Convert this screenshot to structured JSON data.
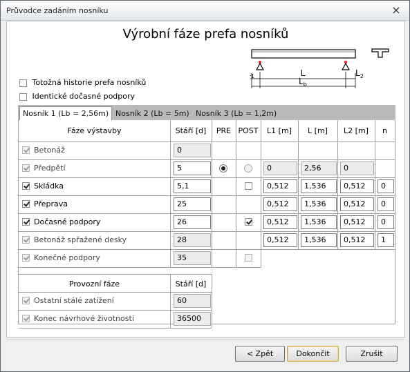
{
  "window": {
    "title": "Průvodce zadáním nosníku",
    "close_label": "×"
  },
  "heading": "Výrobní fáze prefa nosníků",
  "diagram": {
    "l1": "L",
    "l1_sub": "1",
    "l": "L",
    "l2": "L",
    "l2_sub": "2",
    "lb": "L",
    "lb_sub": "b"
  },
  "options": [
    {
      "label": "Totožná historie prefa nosníků",
      "checked": false
    },
    {
      "label": "Identické dočasné podpory",
      "checked": false
    }
  ],
  "tabs": [
    {
      "label": "Nosník  1 (Lb = 2,56m)",
      "active": true
    },
    {
      "label": "Nosník  2 (Lb = 5m)",
      "active": false
    },
    {
      "label": "Nosník  3 (Lb = 1,2m)",
      "active": false
    }
  ],
  "table": {
    "headers": {
      "phase": "Fáze výstavby",
      "age": "Stáří [d]",
      "pre": "PRE",
      "post": "POST",
      "l1": "L1 [m]",
      "l": "L [m]",
      "l2": "L2 [m]",
      "n": "n"
    },
    "rows": [
      {
        "label": "Betonáž",
        "age": "0"
      },
      {
        "label": "Předpětí",
        "age": "5",
        "l1": "0",
        "l": "2,56",
        "l2": "0"
      },
      {
        "label": "Skládka",
        "age": "5,1",
        "l1": "0,512",
        "l": "1,536",
        "l2": "0,512",
        "n": "0"
      },
      {
        "label": "Přeprava",
        "age": "25",
        "l1": "0,512",
        "l": "1,536",
        "l2": "0,512",
        "n": "0"
      },
      {
        "label": "Dočasné podpory",
        "age": "26",
        "l1": "0,512",
        "l": "1,536",
        "l2": "0,512",
        "n": "0"
      },
      {
        "label": "Betonáž spřažené desky",
        "age": "28",
        "l1": "0,512",
        "l": "1,536",
        "l2": "0,512",
        "n": "1"
      },
      {
        "label": "Konečné podpory",
        "age": "35"
      }
    ]
  },
  "service": {
    "headers": {
      "phase": "Provozní fáze",
      "age": "Stáří [d]"
    },
    "rows": [
      {
        "label": "Ostatní stálé zatížení",
        "age": "60"
      },
      {
        "label": "Konec návrhové životnosti",
        "age": "36500"
      }
    ]
  },
  "buttons": {
    "back": "< Zpět",
    "finish": "Dokončit",
    "cancel": "Zrušit"
  },
  "colors": {
    "tab_strip": "#b9b9b9",
    "support_dot": "#e03030",
    "disabled_field": "#ececec"
  }
}
